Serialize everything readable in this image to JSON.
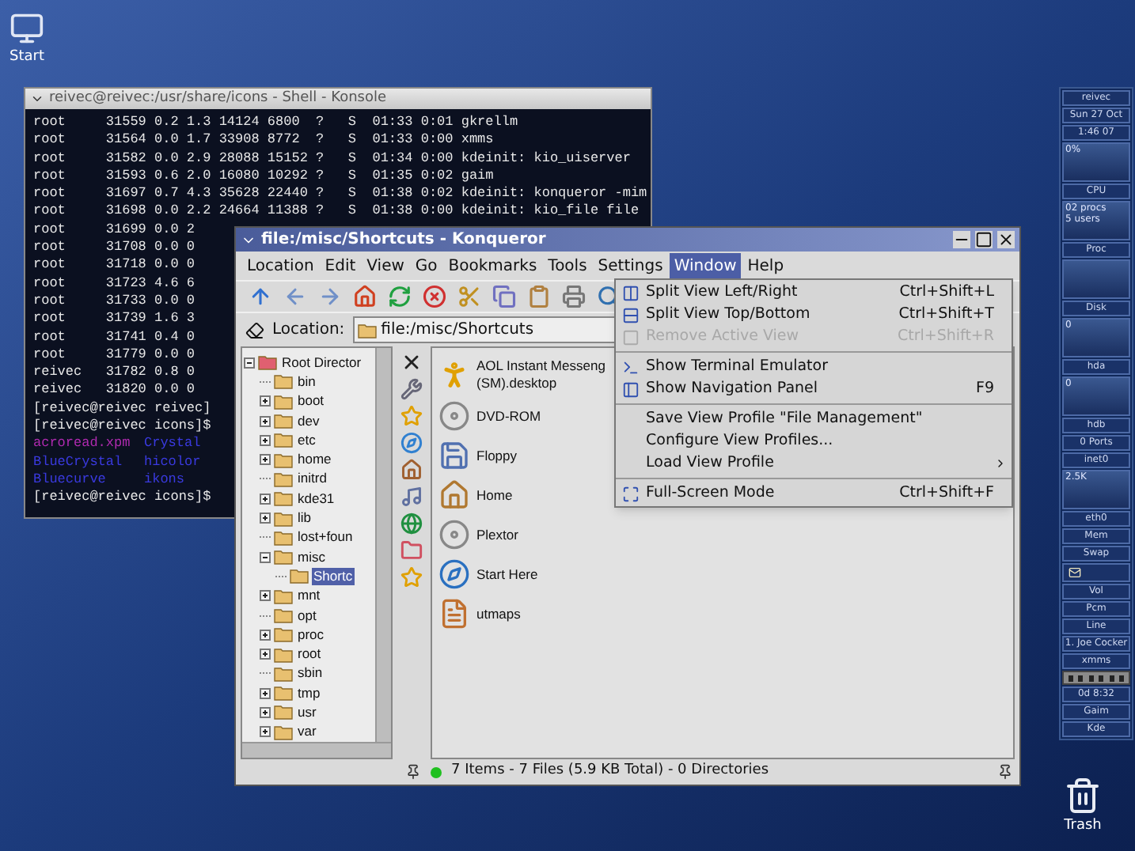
{
  "start_icon": {
    "label": "Start"
  },
  "trash_icon": {
    "label": "Trash"
  },
  "konsole": {
    "title": "reivec@reivec:/usr/share/icons - Shell - Konsole",
    "lines": [
      {
        "kind": "plain",
        "text": "root     31559 0.2 1.3 14124 6800  ?   S  01:33 0:01 gkrellm"
      },
      {
        "kind": "plain",
        "text": "root     31564 0.0 1.7 33908 8772  ?   S  01:33 0:00 xmms"
      },
      {
        "kind": "plain",
        "text": "root     31582 0.0 2.9 28088 15152 ?   S  01:34 0:00 kdeinit: kio_uiserver"
      },
      {
        "kind": "plain",
        "text": "root     31593 0.6 2.0 16080 10292 ?   S  01:35 0:02 gaim"
      },
      {
        "kind": "plain",
        "text": "root     31697 0.7 4.3 35628 22440 ?   S  01:38 0:02 kdeinit: konqueror -mim"
      },
      {
        "kind": "plain",
        "text": "root     31698 0.0 2.2 24664 11388 ?   S  01:38 0:00 kdeinit: kio_file file"
      },
      {
        "kind": "plain",
        "text": "root     31699 0.0 2"
      },
      {
        "kind": "plain",
        "text": "root     31708 0.0 0"
      },
      {
        "kind": "plain",
        "text": "root     31718 0.0 0"
      },
      {
        "kind": "plain",
        "text": "root     31723 4.6 6"
      },
      {
        "kind": "plain",
        "text": "root     31733 0.0 0"
      },
      {
        "kind": "plain",
        "text": "root     31739 1.6 3"
      },
      {
        "kind": "plain",
        "text": "root     31741 0.4 0"
      },
      {
        "kind": "plain",
        "text": "root     31779 0.0 0"
      },
      {
        "kind": "plain",
        "text": "reivec   31782 0.8 0"
      },
      {
        "kind": "plain",
        "text": "reivec   31820 0.0 0"
      },
      {
        "kind": "plain",
        "text": "[reivec@reivec reivec]"
      },
      {
        "kind": "plain",
        "text": "[reivec@reivec icons]$"
      },
      {
        "kind": "listing",
        "cells": [
          {
            "text": "acroread.xpm",
            "color": "#b02ab0"
          },
          {
            "text": "Crystal",
            "color": "#3a3ae0"
          }
        ]
      },
      {
        "kind": "listing",
        "cells": [
          {
            "text": "BlueCrystal",
            "color": "#3a3ae0"
          },
          {
            "text": "hicolor",
            "color": "#3a3ae0"
          }
        ]
      },
      {
        "kind": "listing",
        "cells": [
          {
            "text": "Bluecurve",
            "color": "#3a3ae0"
          },
          {
            "text": "ikons",
            "color": "#3a3ae0"
          }
        ]
      },
      {
        "kind": "plain",
        "text": "[reivec@reivec icons]$"
      }
    ]
  },
  "konqueror": {
    "title": "file:/misc/Shortcuts - Konqueror",
    "menu": [
      {
        "label": "Location",
        "selected": false
      },
      {
        "label": "Edit",
        "selected": false
      },
      {
        "label": "View",
        "selected": false
      },
      {
        "label": "Go",
        "selected": false
      },
      {
        "label": "Bookmarks",
        "selected": false
      },
      {
        "label": "Tools",
        "selected": false
      },
      {
        "label": "Settings",
        "selected": false
      },
      {
        "label": "Window",
        "selected": true
      },
      {
        "label": "Help",
        "selected": false
      }
    ],
    "location": {
      "label": "Location:",
      "value": "file:/misc/Shortcuts"
    },
    "tree": {
      "label": "Root Director",
      "expanded": true,
      "selected": false,
      "children": [
        {
          "label": "bin",
          "selected": false
        },
        {
          "label": "boot",
          "expanded": false,
          "selected": false
        },
        {
          "label": "dev",
          "expanded": false,
          "selected": false
        },
        {
          "label": "etc",
          "expanded": false,
          "selected": false
        },
        {
          "label": "home",
          "expanded": false,
          "selected": false
        },
        {
          "label": "initrd",
          "selected": false
        },
        {
          "label": "kde31",
          "expanded": false,
          "selected": false
        },
        {
          "label": "lib",
          "expanded": false,
          "selected": false
        },
        {
          "label": "lost+foun",
          "selected": false
        },
        {
          "label": "misc",
          "expanded": true,
          "selected": false,
          "children": [
            {
              "label": "Shortc",
              "selected": true
            }
          ]
        },
        {
          "label": "mnt",
          "expanded": false,
          "selected": false
        },
        {
          "label": "opt",
          "selected": false
        },
        {
          "label": "proc",
          "expanded": false,
          "selected": false
        },
        {
          "label": "root",
          "expanded": false,
          "selected": false
        },
        {
          "label": "sbin",
          "selected": false
        },
        {
          "label": "tmp",
          "expanded": false,
          "selected": false
        },
        {
          "label": "usr",
          "expanded": false,
          "selected": false
        },
        {
          "label": "var",
          "expanded": false,
          "selected": false
        }
      ]
    },
    "files": [
      {
        "kind": "app",
        "name_lines": [
          "AOL Instant Messeng",
          "(SM).desktop"
        ]
      },
      {
        "kind": "disc",
        "name_lines": [
          "DVD-ROM"
        ]
      },
      {
        "kind": "floppy",
        "name_lines": [
          "Floppy"
        ]
      },
      {
        "kind": "home",
        "name_lines": [
          "Home"
        ]
      },
      {
        "kind": "disc",
        "name_lines": [
          "Plextor"
        ]
      },
      {
        "kind": "start",
        "name_lines": [
          "Start Here"
        ]
      },
      {
        "kind": "document",
        "name_lines": [
          "utmaps"
        ]
      }
    ],
    "status": "7 Items - 7 Files (5.9 KB Total) - 0 Directories",
    "window_menu": [
      {
        "kind": "item",
        "label": "Split View Left/Right",
        "shortcut": "Ctrl+Shift+L",
        "disabled": false
      },
      {
        "kind": "item",
        "label": "Split View Top/Bottom",
        "shortcut": "Ctrl+Shift+T",
        "disabled": false
      },
      {
        "kind": "item",
        "label": "Remove Active View",
        "shortcut": "Ctrl+Shift+R",
        "disabled": true
      },
      {
        "kind": "separator"
      },
      {
        "kind": "item",
        "label": "Show Terminal Emulator",
        "disabled": false
      },
      {
        "kind": "item",
        "label": "Show Navigation Panel",
        "shortcut": "F9",
        "disabled": false
      },
      {
        "kind": "separator"
      },
      {
        "kind": "item",
        "label": "Save View Profile \"File Management\"",
        "disabled": false
      },
      {
        "kind": "item",
        "label": "Configure View Profiles...",
        "disabled": false
      },
      {
        "kind": "submenu",
        "label": "Load View Profile",
        "disabled": false
      },
      {
        "kind": "separator"
      },
      {
        "kind": "item",
        "label": "Full-Screen Mode",
        "shortcut": "Ctrl+Shift+F",
        "disabled": false
      }
    ]
  },
  "gkrellm": [
    {
      "kind": "label",
      "text": "reivec"
    },
    {
      "kind": "label",
      "text": "Sun 27 Oct"
    },
    {
      "kind": "label",
      "text": "1:46 07"
    },
    {
      "kind": "chart",
      "texts": [
        "0%"
      ]
    },
    {
      "kind": "label",
      "text": "CPU"
    },
    {
      "kind": "chart",
      "texts": [
        "02 procs",
        "5 users"
      ]
    },
    {
      "kind": "label",
      "text": "Proc"
    },
    {
      "kind": "chart"
    },
    {
      "kind": "label",
      "text": "Disk"
    },
    {
      "kind": "chart",
      "texts": [
        "0"
      ]
    },
    {
      "kind": "label",
      "text": "hda"
    },
    {
      "kind": "chart",
      "texts": [
        "0"
      ]
    },
    {
      "kind": "label",
      "text": "hdb"
    },
    {
      "kind": "label",
      "text": "0 Ports"
    },
    {
      "kind": "label",
      "text": "inet0"
    },
    {
      "kind": "chart",
      "texts": [
        "2.5K"
      ]
    },
    {
      "kind": "label",
      "text": "eth0"
    },
    {
      "kind": "label",
      "text": "Mem"
    },
    {
      "kind": "label",
      "text": "Swap"
    },
    {
      "kind": "mail"
    },
    {
      "kind": "label",
      "text": "Vol"
    },
    {
      "kind": "label",
      "text": "Pcm"
    },
    {
      "kind": "label",
      "text": "Line"
    },
    {
      "kind": "label",
      "text": "1. Joe Cocker"
    },
    {
      "kind": "label",
      "text": "xmms"
    },
    {
      "kind": "player"
    },
    {
      "kind": "label",
      "text": "0d 8:32"
    },
    {
      "kind": "label",
      "text": "Gaim"
    },
    {
      "kind": "label",
      "text": "Kde"
    }
  ]
}
